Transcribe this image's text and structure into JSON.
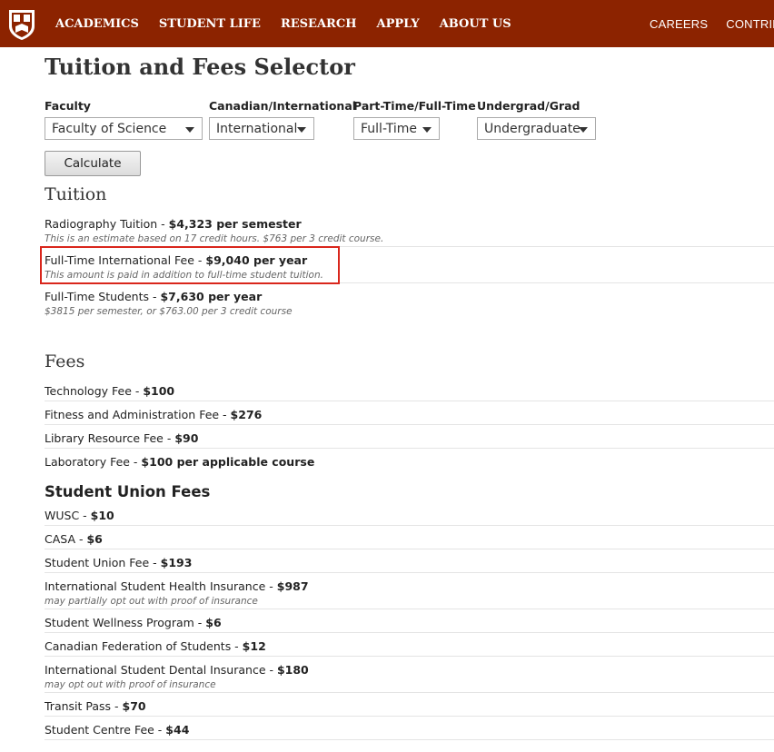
{
  "nav": {
    "left": [
      "ACADEMICS",
      "STUDENT LIFE",
      "RESEARCH",
      "APPLY",
      "ABOUT US"
    ],
    "right": [
      "CAREERS",
      "CONTRIBUT"
    ]
  },
  "page_title": "Tuition and Fees Selector",
  "selectors": {
    "faculty": {
      "label": "Faculty",
      "value": "Faculty of Science"
    },
    "residency": {
      "label": "Canadian/International",
      "value": "International"
    },
    "load": {
      "label": "Part-Time/Full-Time",
      "value": "Full-Time"
    },
    "level": {
      "label": "Undergrad/Grad",
      "value": "Undergraduate"
    }
  },
  "calculate_label": "Calculate",
  "tuition": {
    "heading": "Tuition",
    "items": [
      {
        "name": "Radiography Tuition - ",
        "amount": "$4,323 per semester",
        "note": "This is an estimate based on 17 credit hours. $763 per 3 credit course."
      },
      {
        "name": "Full-Time International Fee - ",
        "amount": "$9,040 per year",
        "note": "This amount is paid in addition to full-time student tuition."
      },
      {
        "name": "Full-Time Students - ",
        "amount": "$7,630 per year",
        "note": "$3815 per semester, or $763.00 per 3 credit course"
      }
    ]
  },
  "fees": {
    "heading": "Fees",
    "items": [
      {
        "name": "Technology Fee - ",
        "amount": "$100"
      },
      {
        "name": "Fitness and Administration Fee - ",
        "amount": "$276"
      },
      {
        "name": "Library Resource Fee - ",
        "amount": "$90"
      },
      {
        "name": "Laboratory Fee - ",
        "amount": "$100 per applicable course"
      }
    ]
  },
  "union_fees": {
    "heading": "Student Union Fees",
    "items": [
      {
        "name": "WUSC - ",
        "amount": "$10",
        "note": ""
      },
      {
        "name": "CASA - ",
        "amount": "$6",
        "note": ""
      },
      {
        "name": "Student Union Fee - ",
        "amount": "$193",
        "note": ""
      },
      {
        "name": "International Student Health Insurance - ",
        "amount": "$987",
        "note": "may partially opt out with proof of insurance"
      },
      {
        "name": "Student Wellness Program - ",
        "amount": "$6",
        "note": ""
      },
      {
        "name": "Canadian Federation of Students - ",
        "amount": "$12",
        "note": ""
      },
      {
        "name": "International Student Dental Insurance - ",
        "amount": "$180",
        "note": "may opt out with proof of insurance"
      },
      {
        "name": "Transit Pass - ",
        "amount": "$70",
        "note": ""
      },
      {
        "name": "Student Centre Fee - ",
        "amount": "$44",
        "note": ""
      }
    ]
  }
}
